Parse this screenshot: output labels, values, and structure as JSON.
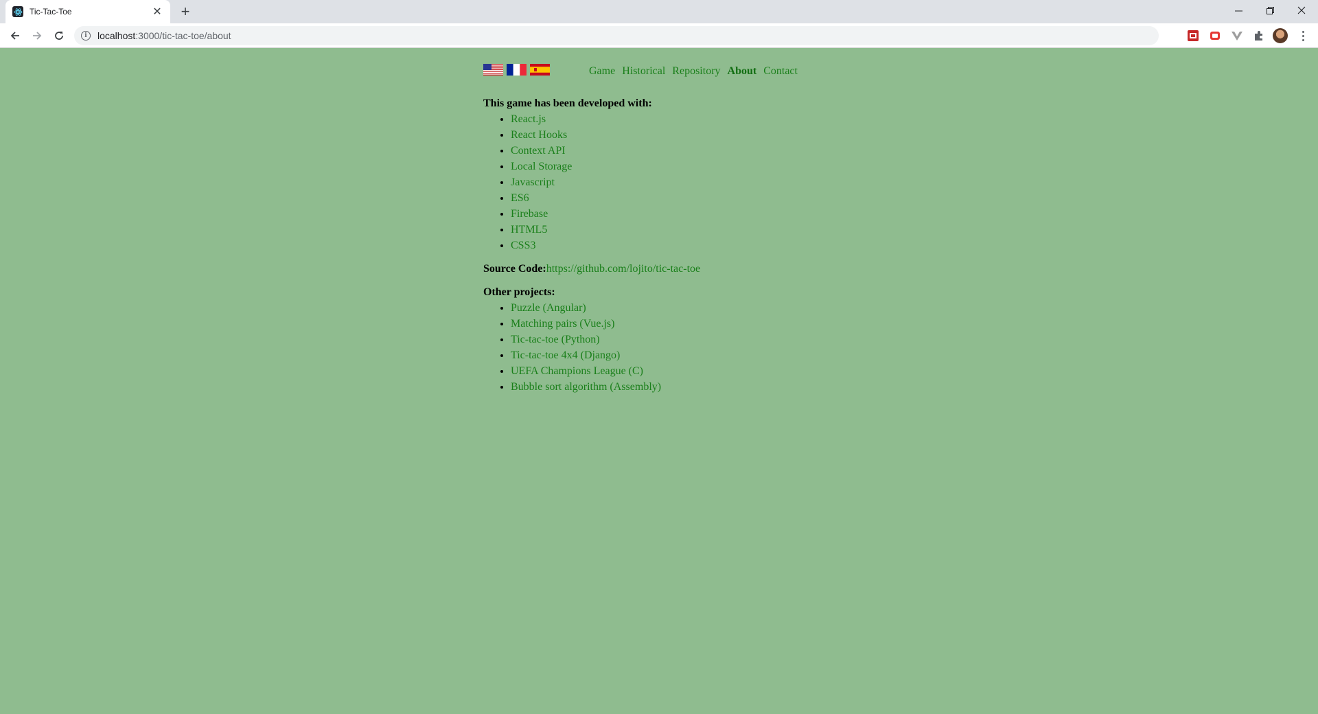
{
  "browser": {
    "tab_title": "Tic-Tac-Toe",
    "url_host": "localhost",
    "url_path": ":3000/tic-tac-toe/about"
  },
  "flags": [
    {
      "name": "United States",
      "icon": "us-flag-icon"
    },
    {
      "name": "France",
      "icon": "france-flag-icon"
    },
    {
      "name": "Spain",
      "icon": "spain-flag-icon"
    }
  ],
  "nav": {
    "game": "Game",
    "historical": "Historical",
    "repository": "Repository",
    "about": "About",
    "contact": "Contact"
  },
  "about": {
    "developed_heading": "This game has been developed with:",
    "technologies": [
      "React.js",
      "React Hooks",
      "Context API",
      "Local Storage",
      "Javascript",
      "ES6",
      "Firebase",
      "HTML5",
      "CSS3"
    ],
    "source_label": "Source Code:",
    "source_url": "https://github.com/lojito/tic-tac-toe",
    "other_heading": "Other projects:",
    "projects": [
      "Puzzle (Angular)",
      "Matching pairs (Vue.js)",
      "Tic-tac-toe (Python)",
      "Tic-tac-toe 4x4 (Django)",
      "UEFA Champions League (C)",
      "Bubble sort algorithm (Assembly)"
    ]
  },
  "colors": {
    "page_background": "#8fbc8f",
    "link": "#1a7f1a"
  }
}
